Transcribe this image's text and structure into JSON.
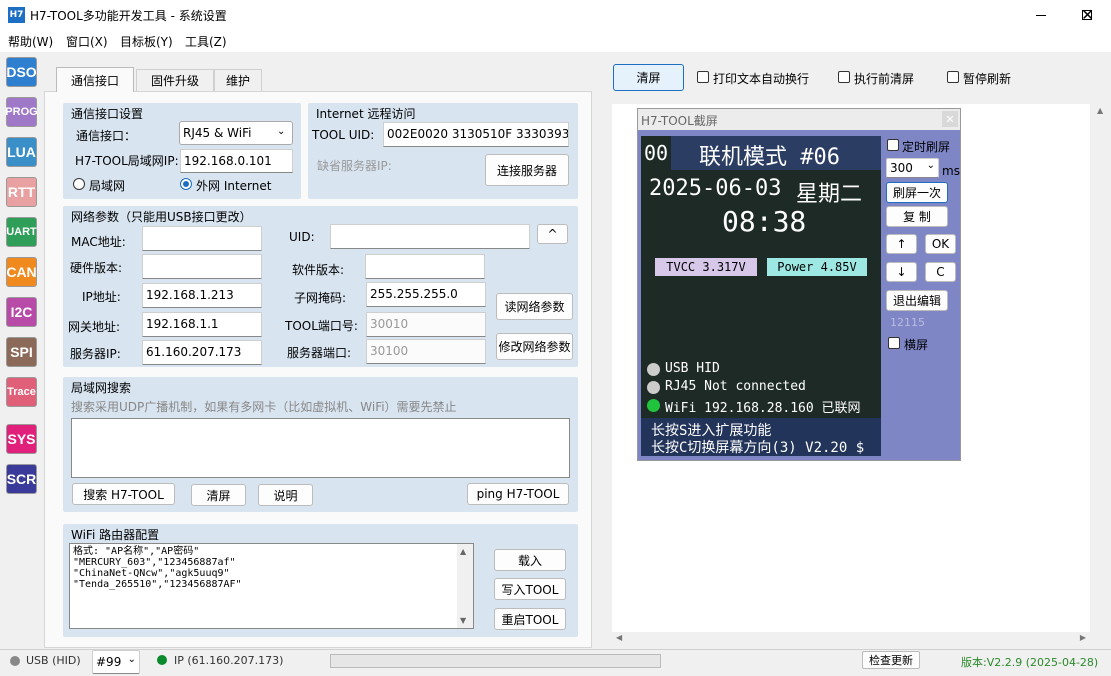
{
  "window": {
    "icon": "H7",
    "title": "H7-TOOL多功能开发工具 - 系统设置"
  },
  "menu": [
    "帮助(W)",
    "窗口(X)",
    "目标板(Y)",
    "工具(Z)"
  ],
  "sidebar": [
    {
      "label": "DSO",
      "color": "#2f7fd1"
    },
    {
      "label": "PROG",
      "color": "#a078c8"
    },
    {
      "label": "LUA",
      "color": "#3a8fc8"
    },
    {
      "label": "RTT",
      "color": "#e8a0a0"
    },
    {
      "label": "UART",
      "color": "#2e9e58"
    },
    {
      "label": "CAN",
      "color": "#f08a1e"
    },
    {
      "label": "I2C",
      "color": "#b84aa8"
    },
    {
      "label": "SPI",
      "color": "#8c6a5a"
    },
    {
      "label": "Trace",
      "color": "#e0607a"
    },
    {
      "label": "SYS",
      "color": "#e0207a"
    },
    {
      "label": "SCR",
      "color": "#3a3a9a"
    }
  ],
  "tabs": [
    "通信接口",
    "固件升级",
    "维护"
  ],
  "comm": {
    "group_title": "通信接口设置",
    "iface_label": "通信接口：",
    "iface_value": "RJ45 & WiFi",
    "lan_ip_label": "H7-TOOL局域网IP:",
    "lan_ip": "192.168.0.101",
    "radio_lan": "局域网",
    "radio_wan": "外网 Internet"
  },
  "remote": {
    "group_title": "Internet 远程访问",
    "uid_label": "TOOL UID:",
    "uid": "002E0020 3130510F 33303938",
    "server_label": "缺省服务器IP:",
    "connect": "连接服务器"
  },
  "net": {
    "group_title": "网络参数（只能用USB接口更改）",
    "mac_label": "MAC地址:",
    "uid_label": "UID:",
    "collapse": "^",
    "hw_label": "硬件版本:",
    "sw_label": "软件版本:",
    "ip_label": "IP地址:",
    "ip": "192.168.1.213",
    "mask_label": "子网掩码:",
    "mask": "255.255.255.0",
    "gw_label": "网关地址:",
    "gw": "192.168.1.1",
    "port_label": "TOOL端口号:",
    "port": "30010",
    "srvip_label": "服务器IP:",
    "srvip": "61.160.207.173",
    "srvport_label": "服务器端口:",
    "srvport": "30100",
    "read": "读网络参数",
    "modify": "修改网络参数"
  },
  "search": {
    "group_title": "局域网搜索",
    "hint": "搜索采用UDP广播机制，如果有多网卡（比如虚拟机、WiFi）需要先禁止",
    "search": "搜索 H7-TOOL",
    "clear": "清屏",
    "help": "说明",
    "ping": "ping H7-TOOL"
  },
  "wifi": {
    "group_title": "WiFi 路由器配置",
    "lines": [
      "格式: \"AP名称\",\"AP密码\"",
      "\"MERCURY_603\",\"123456887af\"",
      "\"ChinaNet-QNcw\",\"agk5uuq9\"",
      "\"Tenda_265510\",\"123456887AF\""
    ],
    "load": "载入",
    "write": "写入TOOL",
    "restart": "重启TOOL"
  },
  "right_toolbar": {
    "clear": "清屏",
    "opt1": "打印文本自动换行",
    "opt2": "执行前清屏",
    "opt3": "暂停刷新"
  },
  "screen": {
    "title": "H7-TOOL截屏",
    "lcd_num": "00",
    "lcd_mode": "联机模式 #06",
    "date": "2025-06-03",
    "weekday": "星期二",
    "time": "08:38",
    "tvcc": "TVCC 3.317V",
    "power": "Power 4.85V",
    "usb": "USB HID",
    "rj45": "RJ45 Not connected",
    "wifi": "WiFi 192.168.28.160 已联网",
    "tip1": "长按S进入扩展功能",
    "tip2": "长按C切换屏幕方向(3) V2.20 $",
    "timed": "定时刷屏",
    "interval": "300",
    "unit": "ms",
    "refresh": "刷屏一次",
    "copy": "复 制",
    "up": "↑",
    "ok": "OK",
    "down": "↓",
    "c": "C",
    "exit": "退出编辑",
    "count": "12115",
    "landscape": "横屏"
  },
  "status": {
    "usb": "USB (HID)",
    "port": "#99",
    "ip": "IP (61.160.207.173)",
    "check": "检查更新",
    "version": "版本:V2.2.9 (2025-04-28)"
  },
  "colors": {
    "accent": "#1d6fc4",
    "lcd_bg": "#1e2a26",
    "lcd_header": "#2b3d63",
    "lcd_footer": "#22345a",
    "frame": "#7e86c6",
    "led_on": "#22c33c"
  }
}
